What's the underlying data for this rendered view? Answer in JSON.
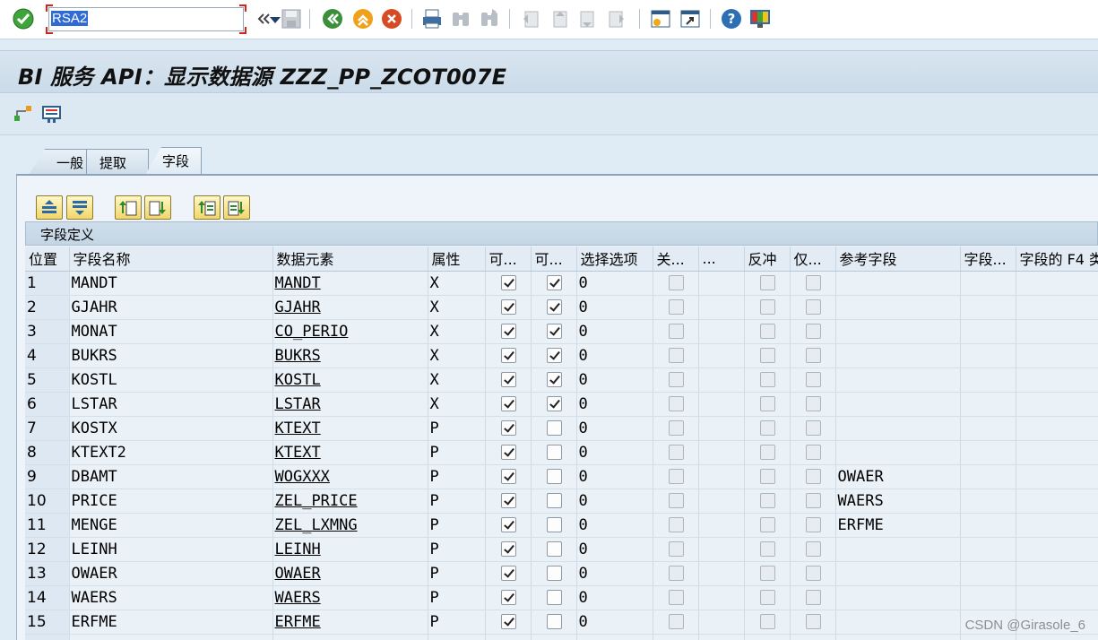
{
  "toolbar": {
    "command_value": "RSA2",
    "icons": [
      "ok-check-icon",
      "back-double-chevron-icon",
      "save-icon",
      "back-icon",
      "exit-icon",
      "cancel-icon",
      "print-icon",
      "find-icon",
      "find-next-icon",
      "first-page-icon",
      "previous-page-icon",
      "next-page-icon",
      "last-page-icon",
      "create-session-icon",
      "shortcut-icon",
      "help-icon",
      "customize-layout-icon"
    ]
  },
  "title": "BI 服务 API：显示数据源 ZZZ_PP_ZCOT007E",
  "app_toolbar": {
    "icons": [
      "hierarchy-icon",
      "display-object-icon"
    ]
  },
  "tabs": [
    {
      "label": "一般",
      "active": false
    },
    {
      "label": "提取",
      "active": false
    },
    {
      "label": "字段",
      "active": true
    }
  ],
  "table_buttons": [
    "select-all-icon",
    "deselect-all-icon",
    "move-up-icon",
    "move-down-icon",
    "sort-ascending-icon",
    "sort-descending-icon"
  ],
  "table": {
    "caption": "字段定义",
    "columns": [
      "位置",
      "字段名称",
      "数据元素",
      "属性",
      "可...",
      "可...",
      "选择选项",
      "关...",
      "...",
      "反冲",
      "仅...",
      "参考字段",
      "字段...",
      "字段的 F4 类"
    ],
    "rows": [
      {
        "pos": "1",
        "field": "MANDT",
        "element": "MANDT",
        "attr": "X",
        "c1": true,
        "c2": true,
        "opt": "0",
        "ref": ""
      },
      {
        "pos": "2",
        "field": "GJAHR",
        "element": "GJAHR",
        "attr": "X",
        "c1": true,
        "c2": true,
        "opt": "0",
        "ref": ""
      },
      {
        "pos": "3",
        "field": "MONAT",
        "element": "CO_PERIO",
        "attr": "X",
        "c1": true,
        "c2": true,
        "opt": "0",
        "ref": ""
      },
      {
        "pos": "4",
        "field": "BUKRS",
        "element": "BUKRS",
        "attr": "X",
        "c1": true,
        "c2": true,
        "opt": "0",
        "ref": ""
      },
      {
        "pos": "5",
        "field": "KOSTL",
        "element": "KOSTL",
        "attr": "X",
        "c1": true,
        "c2": true,
        "opt": "0",
        "ref": ""
      },
      {
        "pos": "6",
        "field": "LSTAR",
        "element": "LSTAR",
        "attr": "X",
        "c1": true,
        "c2": true,
        "opt": "0",
        "ref": ""
      },
      {
        "pos": "7",
        "field": "KOSTX",
        "element": "KTEXT",
        "attr": "P",
        "c1": true,
        "c2": false,
        "opt": "0",
        "ref": ""
      },
      {
        "pos": "8",
        "field": "KTEXT2",
        "element": "KTEXT",
        "attr": "P",
        "c1": true,
        "c2": false,
        "opt": "0",
        "ref": ""
      },
      {
        "pos": "9",
        "field": "DBAMT",
        "element": "WOGXXX",
        "attr": "P",
        "c1": true,
        "c2": false,
        "opt": "0",
        "ref": "OWAER"
      },
      {
        "pos": "10",
        "field": "PRICE",
        "element": "ZEL_PRICE",
        "attr": "P",
        "c1": true,
        "c2": false,
        "opt": "0",
        "ref": "WAERS"
      },
      {
        "pos": "11",
        "field": "MENGE",
        "element": "ZEL_LXMNG",
        "attr": "P",
        "c1": true,
        "c2": false,
        "opt": "0",
        "ref": "ERFME"
      },
      {
        "pos": "12",
        "field": "LEINH",
        "element": "LEINH",
        "attr": "P",
        "c1": true,
        "c2": false,
        "opt": "0",
        "ref": ""
      },
      {
        "pos": "13",
        "field": "OWAER",
        "element": "OWAER",
        "attr": "P",
        "c1": true,
        "c2": false,
        "opt": "0",
        "ref": ""
      },
      {
        "pos": "14",
        "field": "WAERS",
        "element": "WAERS",
        "attr": "P",
        "c1": true,
        "c2": false,
        "opt": "0",
        "ref": ""
      },
      {
        "pos": "15",
        "field": "ERFME",
        "element": "ERFME",
        "attr": "P",
        "c1": true,
        "c2": false,
        "opt": "0",
        "ref": ""
      }
    ]
  },
  "watermark": "CSDN @Girasole_6"
}
